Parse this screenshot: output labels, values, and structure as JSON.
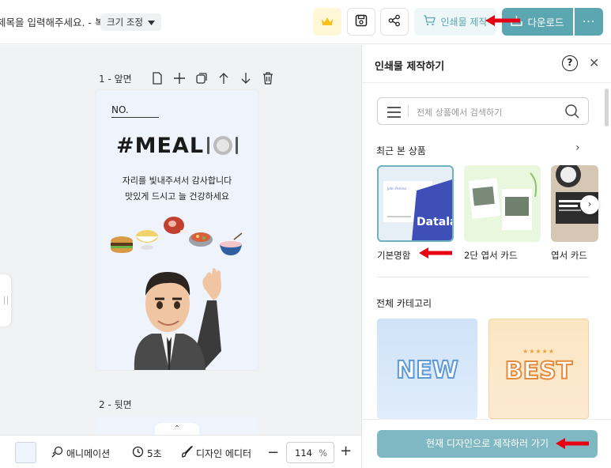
{
  "header": {
    "doc_title": "제목을 입력해주세요. - 복사",
    "size_label": "크기 조정",
    "print_label": "인쇄물 제작",
    "download_label": "다운로드",
    "more_label": "···"
  },
  "canvas": {
    "page1_label": "1 - 앞면",
    "page2_label": "2 - 뒷면",
    "card": {
      "no_label": "NO.",
      "headline": "#MEAL",
      "line1": "자리를 빛내주셔서 감사합니다",
      "line2": "맛있게 드시고 늘 건강하세요"
    }
  },
  "bottombar": {
    "animation_label": "애니메이션",
    "time_label": "5초",
    "editor_label": "디자인 에디터",
    "zoom_value": "114",
    "zoom_unit": "%"
  },
  "panel": {
    "title": "인쇄물 제작하기",
    "search_placeholder": "전체 상품에서 검색하기",
    "recent_title": "최근 본 상품",
    "products": [
      {
        "label": "기본명함",
        "thumb_text": "Datala",
        "thumb_small": "John Perkins"
      },
      {
        "label": "2단 엽서 카드"
      },
      {
        "label": "엽서 카드"
      }
    ],
    "all_categories_title": "전체 카테고리",
    "categories": [
      {
        "label": "NEW"
      },
      {
        "label": "BEST",
        "stars": "★★★★★"
      }
    ],
    "make_button": "현재 디자인으로 제작하러 가기"
  },
  "colors": {
    "accent": "#5ba6b1",
    "card_bg": "#eef3fc",
    "annotation_red": "#e60012"
  }
}
